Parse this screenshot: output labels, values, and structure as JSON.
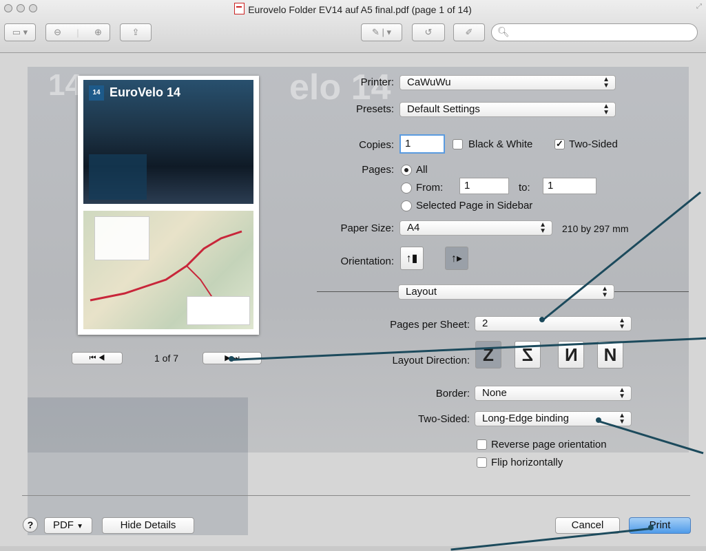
{
  "window": {
    "title": "Eurovelo Folder EV14 auf A5 final.pdf (page 1 of 14)"
  },
  "toolbar": {
    "icons": [
      "sidebar-icon",
      "zoom-out-icon",
      "zoom-in-icon",
      "share-icon",
      "annotate-icon",
      "rotate-icon",
      "edit-icon",
      "search-icon"
    ]
  },
  "preview": {
    "headline": "EuroVelo 14",
    "page_counter": "1 of 7"
  },
  "print": {
    "printer_label": "Printer:",
    "printer_value": "CaWuWu",
    "presets_label": "Presets:",
    "presets_value": "Default Settings",
    "copies_label": "Copies:",
    "copies_value": "1",
    "bw_label": "Black & White",
    "bw_checked": false,
    "two_sided_label": "Two-Sided",
    "two_sided_checked": true,
    "pages_label": "Pages:",
    "pages_all": "All",
    "pages_from": "From:",
    "from_value": "1",
    "pages_to": "to:",
    "to_value": "1",
    "selected_page": "Selected Page in Sidebar",
    "paper_size_label": "Paper Size:",
    "paper_size_value": "A4",
    "paper_size_dims": "210 by 297 mm",
    "orientation_label": "Orientation:",
    "section_value": "Layout",
    "pages_per_sheet_label": "Pages per Sheet:",
    "pages_per_sheet_value": "2",
    "layout_direction_label": "Layout Direction:",
    "border_label": "Border:",
    "border_value": "None",
    "two_sided_setting_label": "Two-Sided:",
    "two_sided_setting_value": "Long-Edge binding",
    "reverse_label": "Reverse page orientation",
    "flip_label": "Flip horizontally"
  },
  "footer": {
    "help": "?",
    "pdf": "PDF",
    "hide_details": "Hide Details",
    "cancel": "Cancel",
    "print": "Print"
  }
}
